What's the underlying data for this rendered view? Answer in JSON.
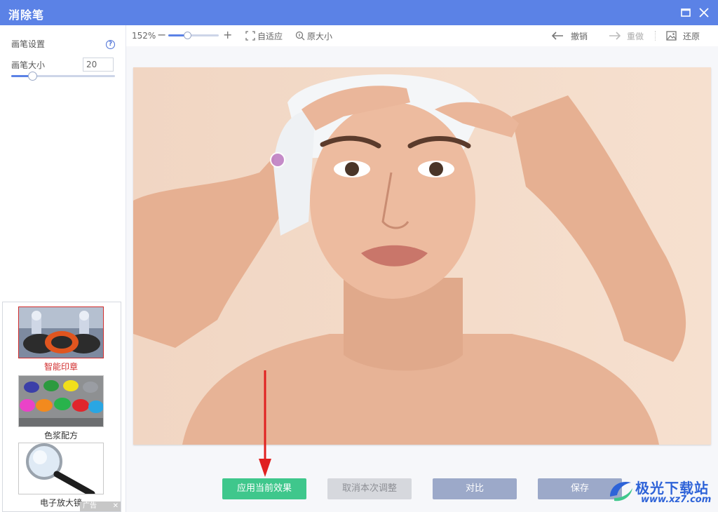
{
  "window": {
    "title": "消除笔"
  },
  "brush": {
    "section_title": "画笔设置",
    "size_label": "画笔大小",
    "size_value": "20",
    "size_fraction": 0.2
  },
  "toolbar": {
    "zoom": "152%",
    "zoom_fraction": 0.38,
    "fit_label": "自适应",
    "original_label": "原大小",
    "undo_label": "撤销",
    "redo_label": "重做",
    "restore_label": "还原"
  },
  "ads": [
    {
      "label": "智能印章",
      "icon": "stamp-image"
    },
    {
      "label": "色浆配方",
      "icon": "paint-cups-image"
    },
    {
      "label": "电子放大镜",
      "icon": "magnifier-image"
    }
  ],
  "ad_badge": "广告",
  "actions": {
    "apply": "应用当前效果",
    "cancel": "取消本次调整",
    "compare": "对比",
    "save": "保存"
  },
  "watermark": {
    "name": "极光下载站",
    "url": "www.xz7.com"
  },
  "colors": {
    "titlebar": "#5b82e6",
    "apply": "#3fc78c",
    "secondary": "#9ca9c9",
    "disabled": "#d6d8dd",
    "annotation": "#e02020"
  }
}
